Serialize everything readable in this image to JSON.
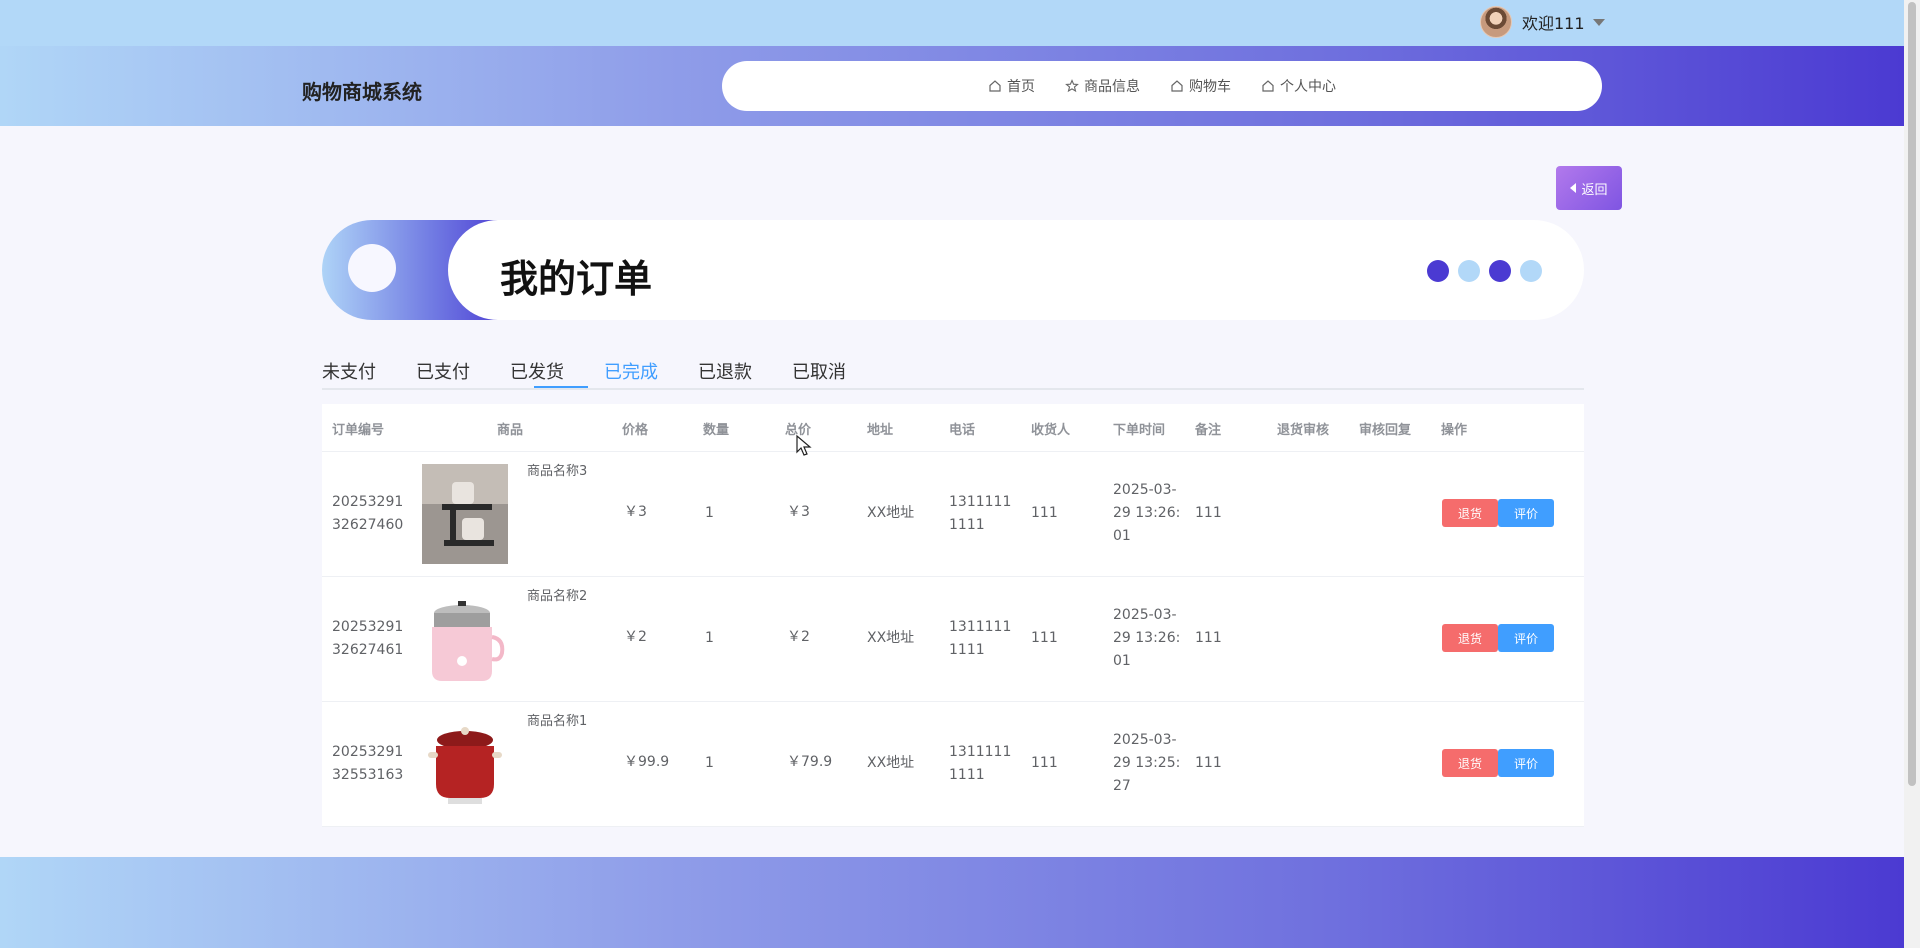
{
  "user": {
    "name": "欢迎111"
  },
  "brand": "购物商城系统",
  "nav": [
    {
      "label": "首页",
      "icon": "home-icon"
    },
    {
      "label": "商品信息",
      "icon": "star-icon"
    },
    {
      "label": "购物车",
      "icon": "home-icon"
    },
    {
      "label": "个人中心",
      "icon": "home-icon"
    }
  ],
  "back_label": "返回",
  "page_title": "我的订单",
  "dots_colors": [
    "#4b3ad2",
    "#b2d8f8",
    "#4b3ad2",
    "#b2d8f8"
  ],
  "tabs": [
    "未支付",
    "已支付",
    "已发货",
    "已完成",
    "已退款",
    "已取消"
  ],
  "active_tab": "已完成",
  "columns": [
    "订单编号",
    "商品",
    "价格",
    "数量",
    "总价",
    "地址",
    "电话",
    "收货人",
    "下单时间",
    "备注",
    "退货审核",
    "审核回复",
    "操作"
  ],
  "orders": [
    {
      "order_no_1": "20253291",
      "order_no_2": "32627460",
      "product": "商品名称3",
      "price": "￥3",
      "qty": "1",
      "total": "￥3",
      "address": "XX地址",
      "phone_1": "1311111",
      "phone_2": "1111",
      "receiver": "111",
      "time_1": "2025-03-",
      "time_2": "29 13:26:",
      "time_3": "01",
      "note": "111",
      "return_label": "退货",
      "review_label": "评价"
    },
    {
      "order_no_1": "20253291",
      "order_no_2": "32627461",
      "product": "商品名称2",
      "price": "￥2",
      "qty": "1",
      "total": "￥2",
      "address": "XX地址",
      "phone_1": "1311111",
      "phone_2": "1111",
      "receiver": "111",
      "time_1": "2025-03-",
      "time_2": "29 13:26:",
      "time_3": "01",
      "note": "111",
      "return_label": "退货",
      "review_label": "评价"
    },
    {
      "order_no_1": "20253291",
      "order_no_2": "32553163",
      "product": "商品名称1",
      "price": "￥99.9",
      "qty": "1",
      "total": "￥79.9",
      "address": "XX地址",
      "phone_1": "1311111",
      "phone_2": "1111",
      "receiver": "111",
      "time_1": "2025-03-",
      "time_2": "29 13:25:",
      "time_3": "27",
      "note": "111",
      "return_label": "退货",
      "review_label": "评价"
    }
  ],
  "colors": {
    "accent": "#409eff",
    "danger": "#f56c6c",
    "brand_dark": "#4b3ad2",
    "brand_light": "#b2d8f8"
  }
}
